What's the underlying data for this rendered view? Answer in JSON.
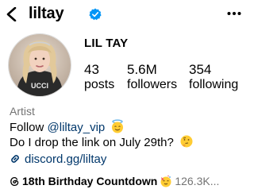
{
  "header": {
    "username": "liltay",
    "back_icon": "chevron-left-icon",
    "verified_icon": "verified-badge-icon",
    "more_icon": "more-horizontal-icon"
  },
  "profile": {
    "display_name": "LIL TAY",
    "avatar_icon": "profile-picture",
    "stats": [
      {
        "value": "43",
        "label": "posts"
      },
      {
        "value": "5.6M",
        "label": "followers"
      },
      {
        "value": "354",
        "label": "following"
      }
    ],
    "category": "Artist",
    "bio_line1_prefix": "Follow ",
    "bio_mention": "@liltay_vip",
    "bio_line1_emoji": "smiling-face-with-halo-emoji",
    "bio_line2": "Do I drop the link on July 29th?",
    "bio_line2_emoji": "thinking-face-emoji",
    "link_icon": "link-icon",
    "link": "discord.gg/liltay",
    "threads_icon": "threads-icon",
    "threads_title": "18th Birthday Countdown",
    "threads_emoji": "partying-face-emoji",
    "threads_count": "126.3K..."
  },
  "colors": {
    "verified": "#0095f6",
    "link": "#00376b",
    "secondary_text": "#737373"
  }
}
